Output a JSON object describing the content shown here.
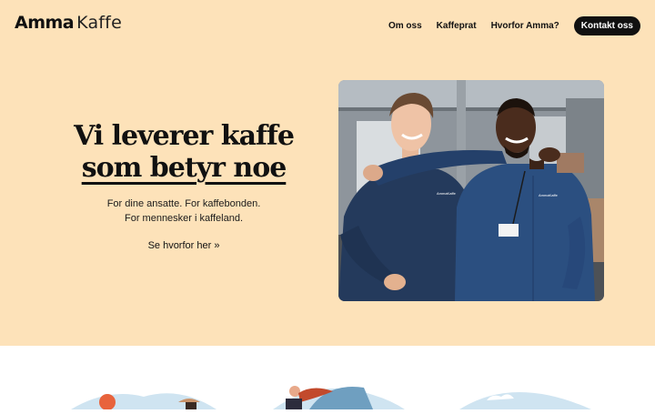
{
  "brand": {
    "name_bold": "Amma",
    "name_light": "Kaffe"
  },
  "nav": {
    "items": [
      "Om oss",
      "Kaffeprat",
      "Hvorfor Amma?"
    ],
    "cta": "Kontakt oss"
  },
  "hero": {
    "headline_line1": "Vi leverer kaffe",
    "headline_line2": "som betyr noe",
    "sub_line1": "For dine ansatte. For kaffebonden.",
    "sub_line2": "For mennesker i kaffeland.",
    "link": "Se hvorfor her »",
    "photo_shirt_text": "AmmaKaffe"
  },
  "colors": {
    "hero_bg": "#fde2b9",
    "text": "#111111",
    "cta_bg": "#111111",
    "shirt": "#243a5c"
  }
}
